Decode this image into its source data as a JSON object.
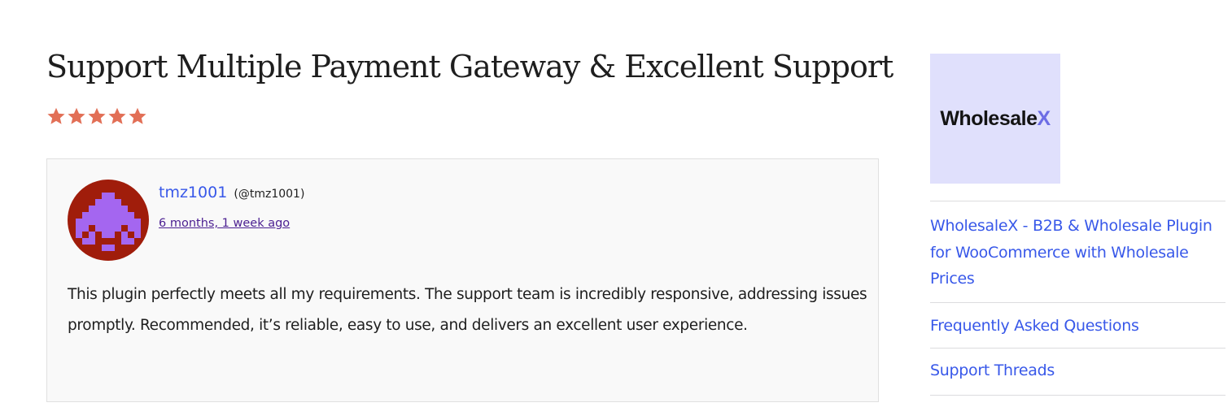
{
  "review": {
    "title": "Support Multiple Payment Gateway & Excellent Support",
    "rating": 5,
    "rating_max": 5,
    "star_color": "#e26f56",
    "author": {
      "name": "tmz1001",
      "handle": "(@tmz1001)"
    },
    "date": "6 months, 1 week ago",
    "body": "This plugin perfectly meets all my requirements. The support team is incredibly responsive, addressing issues promptly. Recommended, it’s reliable, easy to use, and delivers an excellent user experience."
  },
  "sidebar": {
    "logo": {
      "text_main": "Wholesale",
      "text_accent": "X",
      "background": "#e0e0fc"
    },
    "links": [
      {
        "label": "WholesaleX - B2B & Wholesale Plugin for WooCommerce with Wholesale Prices"
      },
      {
        "label": "Frequently Asked Questions"
      },
      {
        "label": "Support Threads"
      }
    ]
  },
  "colors": {
    "link": "#3858e9",
    "visited_link": "#4b1f91",
    "avatar_bg": "#a01d0b",
    "avatar_fg": "#a466f0"
  }
}
